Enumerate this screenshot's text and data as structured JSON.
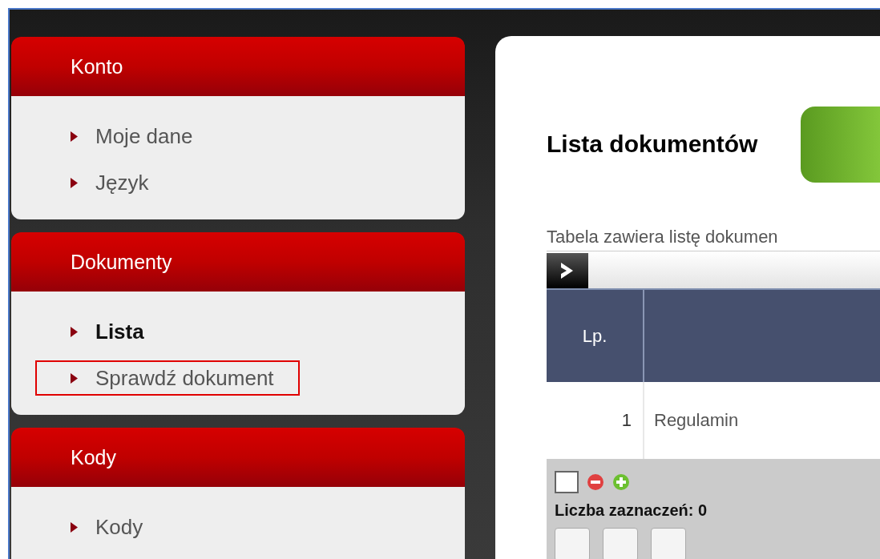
{
  "sidebar": {
    "sections": [
      {
        "title": "Konto",
        "items": [
          {
            "label": "Moje dane",
            "selected": false,
            "highlighted": false
          },
          {
            "label": "Język",
            "selected": false,
            "highlighted": false
          }
        ]
      },
      {
        "title": "Dokumenty",
        "items": [
          {
            "label": "Lista",
            "selected": true,
            "highlighted": false
          },
          {
            "label": "Sprawdź dokument",
            "selected": false,
            "highlighted": true
          }
        ]
      },
      {
        "title": "Kody",
        "items": [
          {
            "label": "Kody",
            "selected": false,
            "highlighted": false
          }
        ]
      }
    ]
  },
  "main": {
    "title": "Lista dokumentów",
    "description": "Tabela zawiera listę dokumen",
    "table": {
      "columns": [
        {
          "label": "Lp."
        }
      ],
      "rows": [
        {
          "lp": "1",
          "name": "Regulamin"
        }
      ]
    },
    "footer": {
      "select_all_checked": false,
      "selection_count": "Liczba zaznaczeń: 0"
    }
  }
}
